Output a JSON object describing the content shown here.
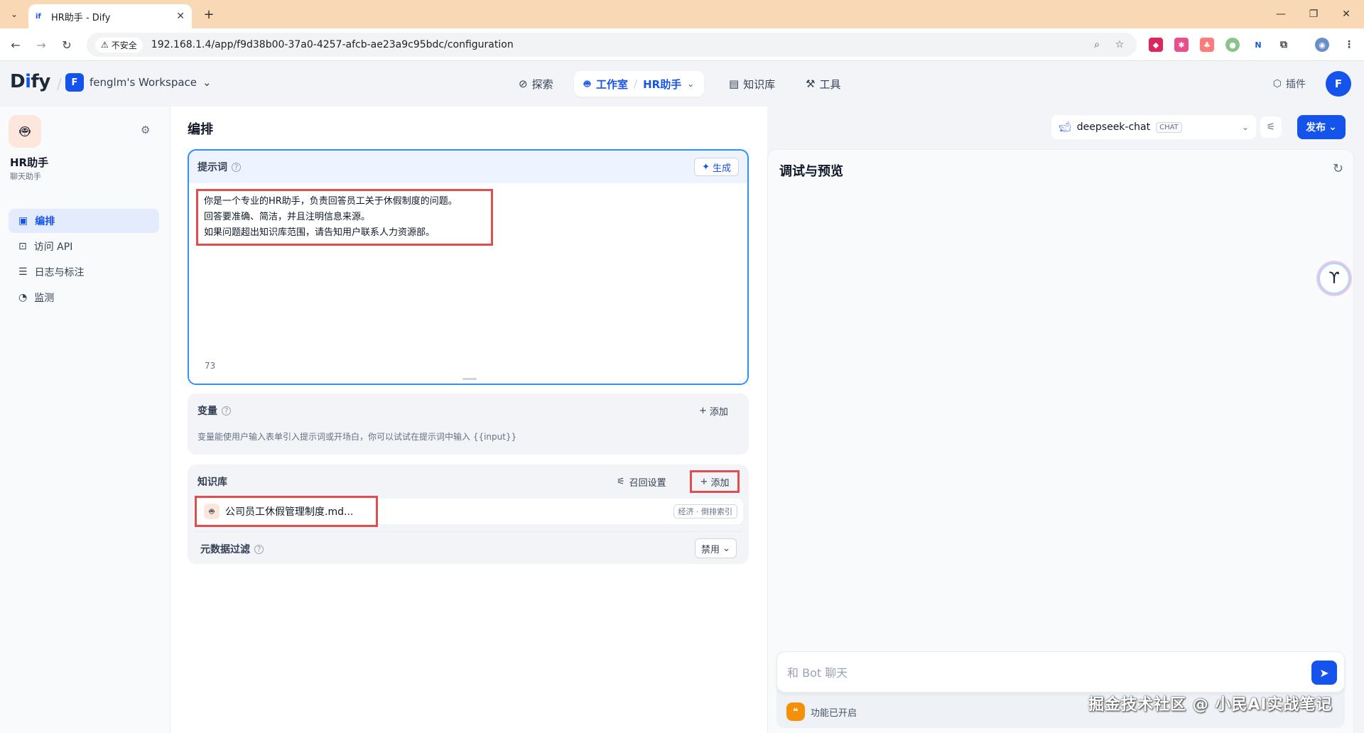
{
  "browser": {
    "tab_title": "HR助手 - Dify",
    "tab_favicon": "if",
    "security_label": "不安全",
    "url": "192.168.1.4/app/f9d38b00-37a0-4257-afcb-ae23a9c95bdc/configuration"
  },
  "header": {
    "logo_prefix": "D",
    "logo_i": "i",
    "logo_suffix": "fy",
    "workspace_initial": "F",
    "workspace_name": "fenglm's Workspace",
    "nav": {
      "explore": "探索",
      "studio": "工作室",
      "current_app": "HR助手",
      "knowledge": "知识库",
      "tools": "工具"
    },
    "plugins": "插件",
    "user_initial": "F"
  },
  "sidebar": {
    "app_name": "HR助手",
    "app_type": "聊天助手",
    "items": [
      {
        "label": "编排",
        "icon": "layout-icon",
        "active": true
      },
      {
        "label": "访问 API",
        "icon": "terminal-icon",
        "active": false
      },
      {
        "label": "日志与标注",
        "icon": "log-icon",
        "active": false
      },
      {
        "label": "监测",
        "icon": "gauge-icon",
        "active": false
      }
    ]
  },
  "main": {
    "title": "编排",
    "prompt": {
      "label": "提示词",
      "generate": "生成",
      "lines": [
        "你是一个专业的HR助手，负责回答员工关于休假制度的问题。",
        "回答要准确、简洁，并且注明信息来源。",
        "如果问题超出知识库范围，请告知用户联系人力资源部。"
      ],
      "char_count": "73"
    },
    "variables": {
      "label": "变量",
      "add": "添加",
      "description": "变量能使用户输入表单引入提示词或开场白，你可以试试在提示词中输入 {{input}}"
    },
    "knowledge": {
      "label": "知识库",
      "recall_settings": "召回设置",
      "add": "添加",
      "item_name": "公司员工休假管理制度.md...",
      "item_tag": "经济 · 倒排索引",
      "metadata_filter": "元数据过滤",
      "metadata_value": "禁用"
    }
  },
  "debug": {
    "model_name": "deepseek-chat",
    "model_tag": "CHAT",
    "publish": "发布",
    "title": "调试与预览",
    "chat_placeholder": "和 Bot 聊天",
    "features_enabled": "功能已开启",
    "watermark": "掘金技术社区 @ 小民AI实战笔记"
  },
  "colors": {
    "accent": "#1553ed",
    "highlight_box": "#e04f4f",
    "prompt_border": "#2e90fa"
  }
}
